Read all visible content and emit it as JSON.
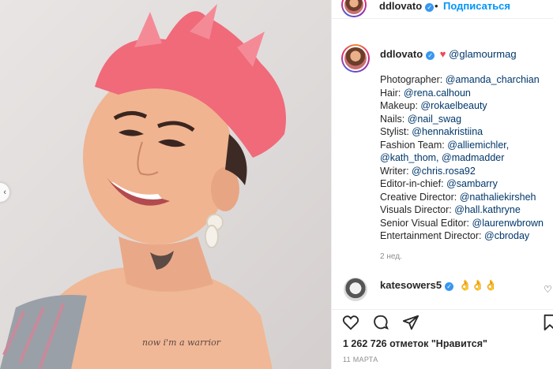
{
  "post": {
    "photo_alt": "",
    "tattoo_text": "now i'm a warrior"
  },
  "header": {
    "username": "ddlovato",
    "separator": "•",
    "follow_label": "Подписаться"
  },
  "caption": {
    "username": "ddlovato",
    "mention_main": "@glamourmag",
    "lines": [
      {
        "label": "Photographer: ",
        "mention": "@amanda_charchian"
      },
      {
        "label": "Hair: ",
        "mention": "@rena.calhoun"
      },
      {
        "label": "Makeup: ",
        "mention": "@rokaelbeauty"
      },
      {
        "label": "Nails: ",
        "mention": "@nail_swag"
      },
      {
        "label": "Stylist: ",
        "mention": "@hennakristiina"
      },
      {
        "label": "Fashion Team: ",
        "mention": "@alliemichler,"
      },
      {
        "label": "",
        "mention": "@kath_thom, @madmadder"
      },
      {
        "label": "Writer: ",
        "mention": "@chris.rosa92"
      },
      {
        "label": "Editor-in-chief: ",
        "mention": "@sambarry"
      },
      {
        "label": "Creative Director: ",
        "mention": "@nathaliekirsheh"
      },
      {
        "label": "Visuals Director: ",
        "mention": "@hall.kathryne"
      },
      {
        "label": "Senior Visual Editor: ",
        "mention": "@laurenwbrown"
      },
      {
        "label": "Entertainment Director: ",
        "mention": "@cbroday"
      }
    ],
    "time_ago": "2 нед."
  },
  "comment": {
    "username": "katesowers5",
    "text": "👌👌👌"
  },
  "actions": {
    "like_icon": "heart-outline-icon",
    "comment_icon": "comment-bubble-icon",
    "share_icon": "paper-plane-icon",
    "save_icon": "bookmark-icon"
  },
  "likes_text": "1 262 726 отметок \"Нравится\"",
  "date_text": "11 МАРТА",
  "colors": {
    "accent": "#0095f6",
    "verified": "#3897f0",
    "mention": "#00376b",
    "hair": "#f06a7a"
  }
}
